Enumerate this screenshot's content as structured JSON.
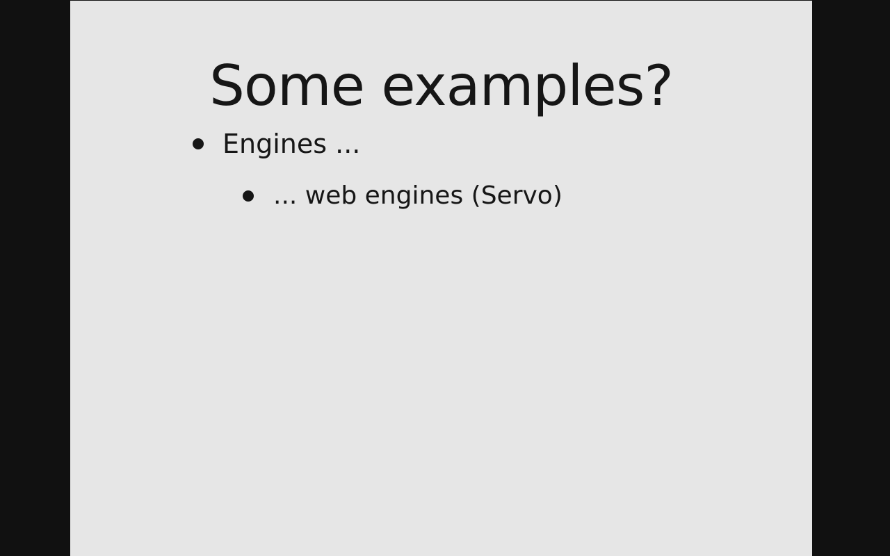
{
  "slide": {
    "title": "Some examples?",
    "bullets": [
      {
        "text": "Engines ..."
      },
      {
        "text": "... web engines (Servo)"
      }
    ]
  },
  "colors": {
    "background": "#111111",
    "slide": "#e6e6e6",
    "text": "#161616"
  }
}
